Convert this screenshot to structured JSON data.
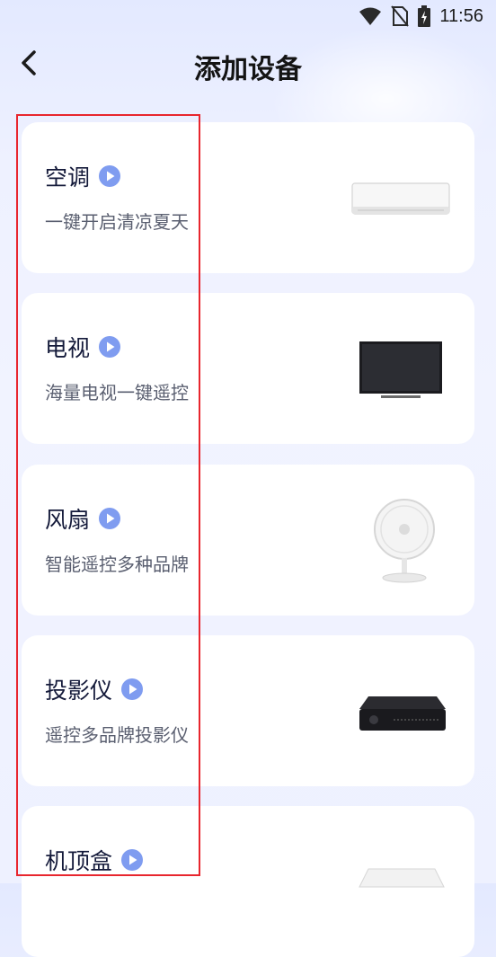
{
  "status_bar": {
    "time": "11:56"
  },
  "header": {
    "title": "添加设备"
  },
  "devices": [
    {
      "name": "空调",
      "description": "一键开启清凉夏天",
      "image": "air-conditioner"
    },
    {
      "name": "电视",
      "description": "海量电视一键遥控",
      "image": "television"
    },
    {
      "name": "风扇",
      "description": "智能遥控多种品牌",
      "image": "electric-fan"
    },
    {
      "name": "投影仪",
      "description": "遥控多品牌投影仪",
      "image": "projector"
    },
    {
      "name": "机顶盒",
      "description": "",
      "image": "set-top-box"
    }
  ],
  "colors": {
    "accent": "#7f9cf0",
    "highlight": "#e8262e",
    "background": "#eef1ff"
  }
}
